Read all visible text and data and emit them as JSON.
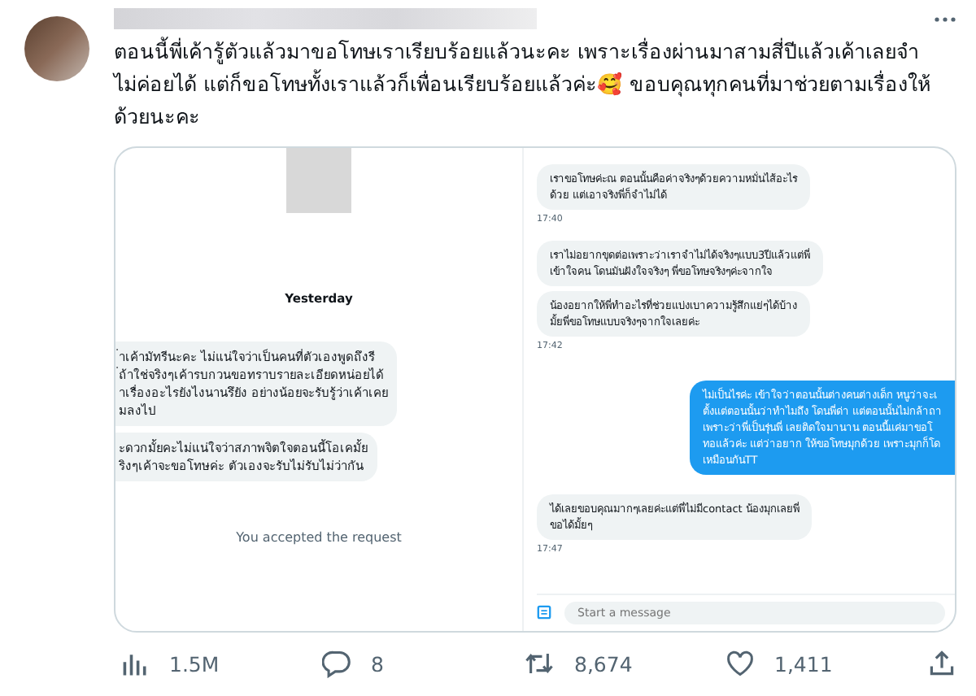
{
  "tweet": {
    "text": "ตอนนี้พี่เค้ารู้ตัวแล้วมาขอโทษเราเรียบร้อยแล้วนะคะ เพราะเรื่องผ่านมาสามสี่ปีแล้วเค้าเลยจำไม่ค่อยได้ แต่ก็ขอโทษทั้งเราแล้วก็เพื่อนเรียบร้อยแล้วค่ะ🥰 ขอบคุณทุกคนที่มาช่วยตามเรื่องให้ด้วยนะคะ"
  },
  "left_chat": {
    "day": "Yesterday",
    "messages": [
      {
        "lines": [
          "่าเค้ามัทรีนะคะ ไม่แน่ใจว่าเป็นคนที่ตัวเองพูดถึงรี",
          "่ถ้าใช่จริงๆเค้ารบกวนขอทราบรายละเอียดหน่อยได้",
          "าเรื่องอะไรยังไงนานรึยัง อย่างน้อยจะรับรู้ว่าเค้าเคย",
          "มลงไป"
        ]
      },
      {
        "lines": [
          "ะดวกมั้ยคะไม่แน่ใจว่าสภาพจิตใจตอนนี้โอเคมั้ย",
          "ริงๆเค้าจะขอโทษค่ะ ตัวเองจะรับไม่รับไม่ว่ากัน"
        ]
      }
    ],
    "notice": "You accepted the request"
  },
  "right_chat": {
    "messages": [
      {
        "kind": "received",
        "lines": [
          "เราขอโทษค่ะณ ตอนนั้นคือค่าจริงๆด้วยความหมั่นไส้อะไร",
          "ด้วย แต่เอาจริงพี่ก็จำไม่ได้"
        ],
        "time": "17:40"
      },
      {
        "kind": "received",
        "lines": [
          "เราไม่อยากขุดต่อเพราะว่าเราจำไม่ได้จริงๆแบบ3ปีแล้วแต่พี่",
          "เข้าใจคน โดนมันฝังใจจริงๆ พี่ขอโทษจริงๆค่ะจากใจ"
        ]
      },
      {
        "kind": "received",
        "lines": [
          "น้องอยากให้พี่ทำอะไรที่ช่วยแบ่งเบาความรู้สึกแย่ๆได้บ้าง",
          "มั้ยพี่ขอโทษแบบจริงๆจากใจเลยค่ะ"
        ],
        "time": "17:42"
      },
      {
        "kind": "sent",
        "lines": [
          "ไม่เป็นไรค่ะ เข้าใจว่าตอนนั้นต่างคนต่างเด็ก หนูว่าจะเ",
          "ตั้งแต่ตอนนั้นว่าทำไมถึง โดนพี่ด่า แต่ตอนนั้นไม่กล้าถา",
          "เพราะว่าพี่เป็นรุ่นพี่ เลยติดใจมานาน ตอนนี้แค่มาขอโ",
          "ทอแล้วค่ะ แต่ว่าอยาก ให้ขอโทษมุกด้วย เพราะมุกก็โด",
          "เหมือนกันTT"
        ]
      },
      {
        "kind": "received",
        "lines": [
          "ได้เลยขอบคุณมากๆเลยค่ะแต่พี่ไม่มีcontact น้องมุกเลยพี่",
          "ขอได้มั้ยๆ"
        ],
        "time": "17:47"
      }
    ],
    "composer": {
      "placeholder": "Start a message"
    }
  },
  "actions": [
    {
      "kind": "views",
      "count": "1.5M"
    },
    {
      "kind": "reply",
      "count": "8"
    },
    {
      "kind": "retweet",
      "count": "8,674"
    },
    {
      "kind": "like",
      "count": "1,411"
    },
    {
      "kind": "share"
    }
  ]
}
